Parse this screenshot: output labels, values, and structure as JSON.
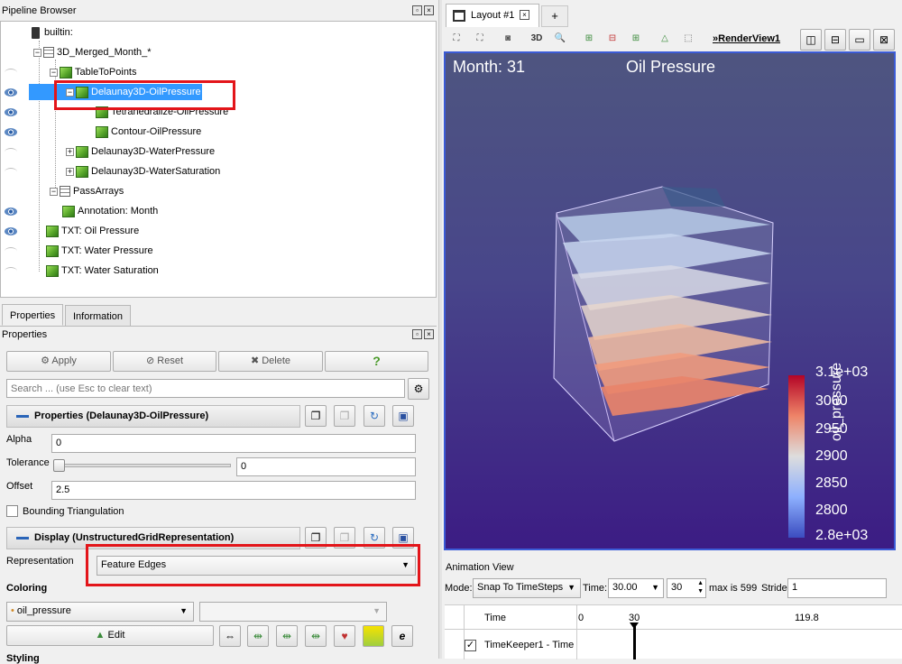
{
  "pipeline": {
    "title": "Pipeline Browser",
    "items": [
      {
        "label": "builtin:"
      },
      {
        "label": "3D_Merged_Month_*"
      },
      {
        "label": "TableToPoints"
      },
      {
        "label": "Delaunay3D-OilPressure"
      },
      {
        "label": "Tetrahedralize-OilPressure"
      },
      {
        "label": "Contour-OilPressure"
      },
      {
        "label": "Delaunay3D-WaterPressure"
      },
      {
        "label": "Delaunay3D-WaterSaturation"
      },
      {
        "label": "PassArrays"
      },
      {
        "label": "Annotation: Month"
      },
      {
        "label": "TXT: Oil Pressure"
      },
      {
        "label": "TXT: Water Pressure"
      },
      {
        "label": "TXT: Water Saturation"
      }
    ]
  },
  "tabs": {
    "properties": "Properties",
    "information": "Information"
  },
  "properties_panel": {
    "title": "Properties",
    "apply": "Apply",
    "reset": "Reset",
    "delete": "Delete",
    "help": "?",
    "search_placeholder": "Search ... (use Esc to clear text)",
    "section_properties": "Properties (Delaunay3D-OilPressure)",
    "alpha_label": "Alpha",
    "alpha_value": "0",
    "tolerance_label": "Tolerance",
    "tolerance_value": "0",
    "offset_label": "Offset",
    "offset_value": "2.5",
    "bounding_label": "Bounding Triangulation",
    "section_display": "Display (UnstructuredGridRepresentation)",
    "representation_label": "Representation",
    "representation_value": "Feature Edges",
    "coloring_label": "Coloring",
    "coloring_value": "oil_pressure",
    "edit_label": "Edit",
    "styling_label": "Styling"
  },
  "layout": {
    "tab_label": "Layout #1",
    "add_tab": "+",
    "view_name": "RenderView1",
    "three_d": "3D"
  },
  "render": {
    "month_text": "Month: 31",
    "title_text": "Oil Pressure",
    "colorbar_title": "oil_pressure",
    "colorbar_ticks": [
      "3.1e+03",
      "3000",
      "2950",
      "2900",
      "2850",
      "2800",
      "2.8e+03"
    ],
    "colors": {
      "bg_top": "#4e4f7b",
      "bg_bottom": "#3a1782",
      "cmap_high": "#b40426",
      "cmap_mid": "#dddddd",
      "cmap_low": "#3b4cc0"
    }
  },
  "animation": {
    "title": "Animation View",
    "mode_label": "Mode:",
    "mode_value": "Snap To TimeSteps",
    "time_label": "Time:",
    "time_value": "30.00",
    "step_value": "30",
    "max_label": "max is 599",
    "stride_label": "Stride",
    "stride_value": "1",
    "col_time": "Time",
    "tick_0": "0",
    "tick_30": "30",
    "tick_119": "119.8",
    "row_label": "TimeKeeper1 - Time"
  }
}
